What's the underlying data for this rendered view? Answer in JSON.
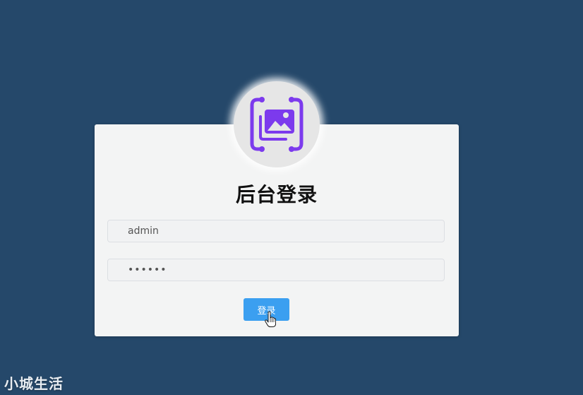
{
  "login": {
    "title": "后台登录",
    "username_value": "admin",
    "password_value": "••••••",
    "button_label": "登录"
  },
  "logo": {
    "icon": "image-gallery-icon",
    "color": "#7c3aed"
  },
  "watermark": {
    "text": "小城生活"
  },
  "colors": {
    "background": "#25486a",
    "card": "#f3f4f4",
    "button": "#3b9ff0"
  }
}
